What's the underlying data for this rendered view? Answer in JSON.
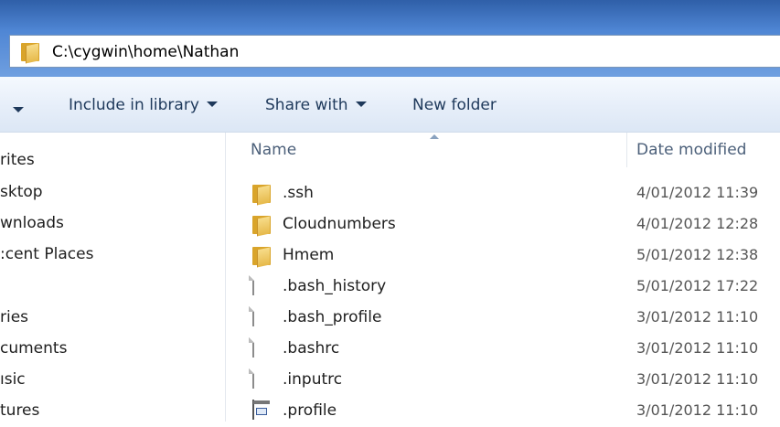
{
  "address": {
    "path": "C:\\cygwin\\home\\Nathan"
  },
  "toolbar": {
    "include_label": "Include in library",
    "share_label": "Share with",
    "new_folder_label": "New folder"
  },
  "nav": {
    "items": [
      {
        "label": "rites",
        "type": "header"
      },
      {
        "label": "sktop",
        "type": "item"
      },
      {
        "label": "wnloads",
        "type": "item"
      },
      {
        "label": ":cent Places",
        "type": "item"
      },
      {
        "label": "ries",
        "type": "header"
      },
      {
        "label": "cuments",
        "type": "item"
      },
      {
        "label": "ısic",
        "type": "item"
      },
      {
        "label": "tures",
        "type": "item"
      }
    ]
  },
  "columns": {
    "name": "Name",
    "date": "Date modified"
  },
  "files": [
    {
      "name": ".ssh",
      "date": "4/01/2012 11:39",
      "icon": "folder-icon"
    },
    {
      "name": "Cloudnumbers",
      "date": "4/01/2012 12:28",
      "icon": "folder-icon"
    },
    {
      "name": "Hmem",
      "date": "5/01/2012 12:38",
      "icon": "folder-icon"
    },
    {
      "name": ".bash_history",
      "date": "5/01/2012 17:22",
      "icon": "file-icon"
    },
    {
      "name": ".bash_profile",
      "date": "3/01/2012 11:10",
      "icon": "file-icon"
    },
    {
      "name": ".bashrc",
      "date": "3/01/2012 11:10",
      "icon": "file-icon"
    },
    {
      "name": ".inputrc",
      "date": "3/01/2012 11:10",
      "icon": "file-icon"
    },
    {
      "name": ".profile",
      "date": "3/01/2012 11:10",
      "icon": "settings-file-icon"
    }
  ]
}
